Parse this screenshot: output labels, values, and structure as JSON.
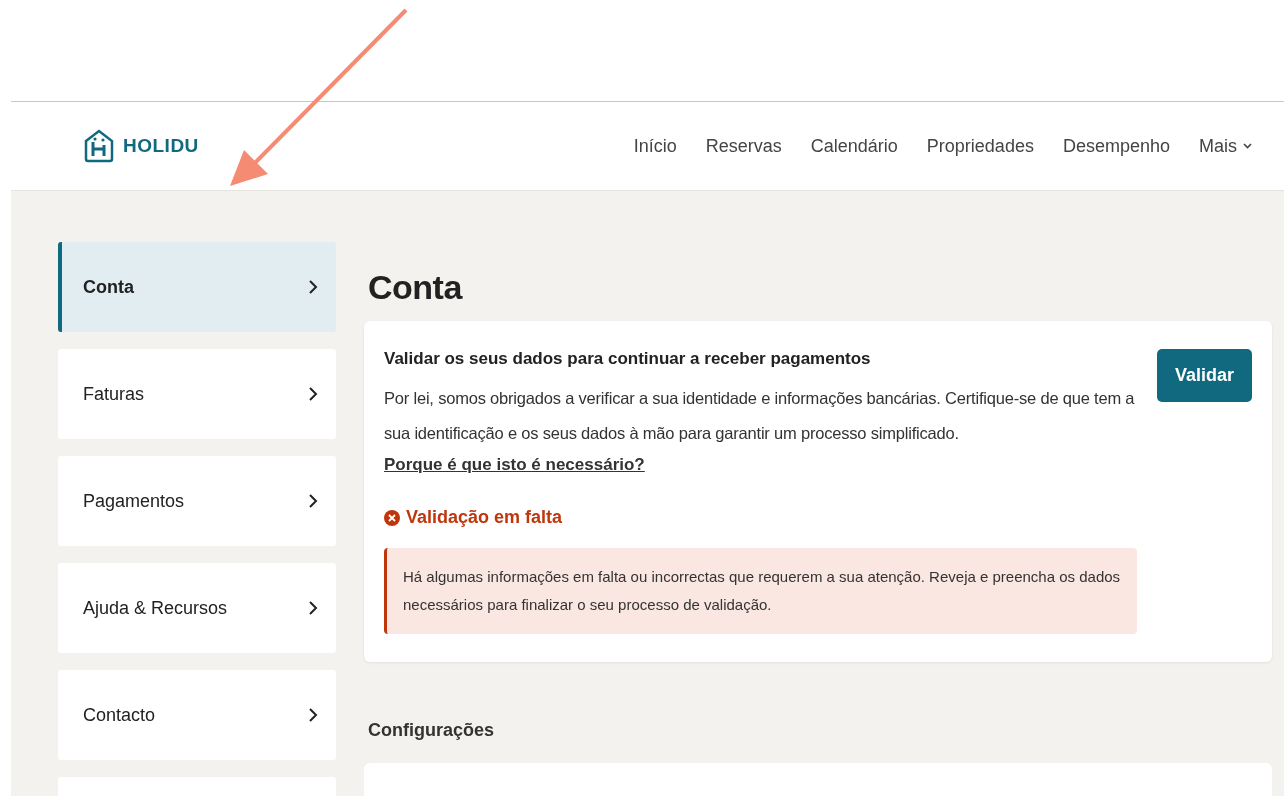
{
  "header": {
    "logo": "HOLIDU",
    "nav": [
      {
        "label": "Início",
        "kind": "link"
      },
      {
        "label": "Reservas",
        "kind": "link"
      },
      {
        "label": "Calendário",
        "kind": "link"
      },
      {
        "label": "Propriedades",
        "kind": "link"
      },
      {
        "label": "Desempenho",
        "kind": "link"
      },
      {
        "label": "Mais",
        "kind": "dropdown"
      }
    ]
  },
  "sidebar": {
    "items": [
      {
        "label": "Conta",
        "selected": true
      },
      {
        "label": "Faturas",
        "selected": false
      },
      {
        "label": "Pagamentos",
        "selected": false
      },
      {
        "label": "Ajuda & Recursos",
        "selected": false
      },
      {
        "label": "Contacto",
        "selected": false
      },
      {
        "selected": false
      }
    ]
  },
  "main": {
    "title": "Conta",
    "validation_card": {
      "heading": "Validar os seus dados para continuar a receber pagamentos",
      "body": "Por lei, somos obrigados a verificar a sua identidade e informações bancárias. Certifique-se de que tem a sua identificação e os seus dados à mão para garantir um processo simplificado.",
      "link": "Porque é que isto é necessário?",
      "button": "Validar",
      "status": "Validação em falta",
      "alert": "Há algumas informações em falta ou incorrectas que requerem a sua atenção. Reveja e preencha os dados necessários para finalizar o seu processo de validação."
    },
    "section_title": "Configurações"
  }
}
